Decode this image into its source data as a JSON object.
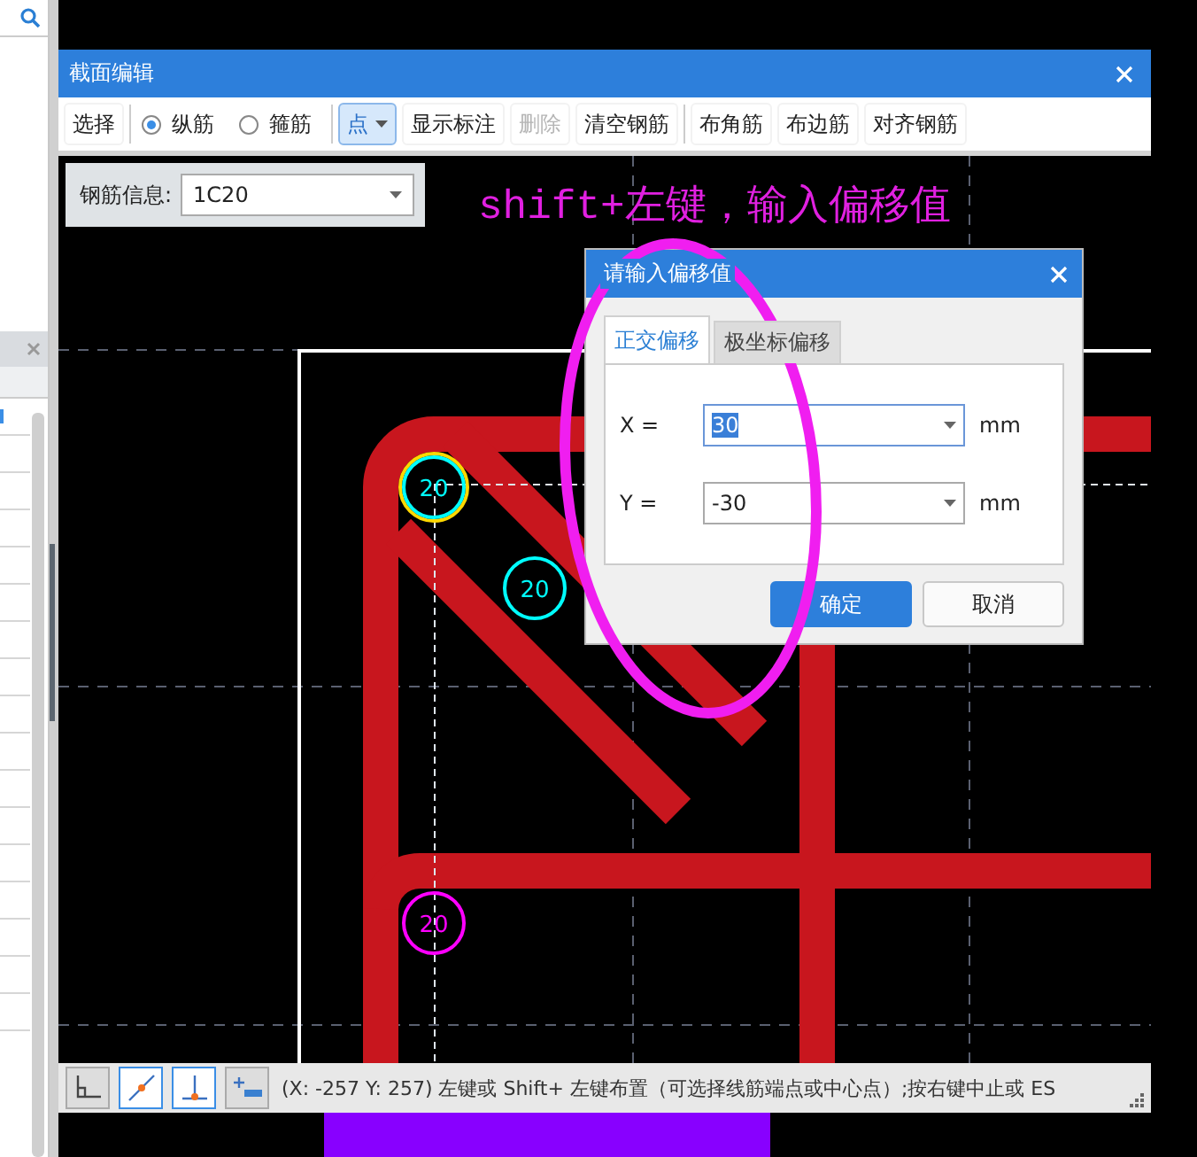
{
  "window": {
    "title": "截面编辑"
  },
  "toolbar": [
    {
      "kind": "button",
      "label": "选择",
      "disabled": false
    },
    {
      "kind": "separator"
    },
    {
      "kind": "radio",
      "label": "纵筋",
      "checked": true
    },
    {
      "kind": "radio",
      "label": "箍筋",
      "checked": false
    },
    {
      "kind": "separator"
    },
    {
      "kind": "dropdown",
      "label": "点",
      "selected": true
    },
    {
      "kind": "button",
      "label": "显示标注",
      "disabled": false
    },
    {
      "kind": "button",
      "label": "删除",
      "disabled": true
    },
    {
      "kind": "button",
      "label": "清空钢筋",
      "disabled": false
    },
    {
      "kind": "separator"
    },
    {
      "kind": "button",
      "label": "布角筋",
      "disabled": false
    },
    {
      "kind": "button",
      "label": "布边筋",
      "disabled": false
    },
    {
      "kind": "button",
      "label": "对齐钢筋",
      "disabled": false
    }
  ],
  "rebar_info": {
    "label": "钢筋信息:",
    "value": "1C20"
  },
  "annotation": "shift+左键，输入偏移值",
  "rebar_marks": [
    {
      "label": "20",
      "color": "#00ffff",
      "highlighted": true
    },
    {
      "label": "20",
      "color": "#00ffff",
      "highlighted": false
    },
    {
      "label": "20",
      "color": "#ff00ff",
      "highlighted": false
    }
  ],
  "dialog": {
    "title": "请输入偏移值",
    "tabs": [
      {
        "label": "正交偏移",
        "selected": true
      },
      {
        "label": "极坐标偏移",
        "selected": false
      }
    ],
    "fields": [
      {
        "label": "X =",
        "value": "30",
        "unit": "mm",
        "selected": true
      },
      {
        "label": "Y =",
        "value": "-30",
        "unit": "mm",
        "selected": false
      }
    ],
    "buttons": [
      {
        "label": "确定",
        "primary": true
      },
      {
        "label": "取消",
        "primary": false
      }
    ]
  },
  "status_bar": {
    "tools": [
      {
        "selected": false
      },
      {
        "selected": true
      },
      {
        "selected": true
      },
      {
        "selected": false
      }
    ],
    "message": "(X: -257 Y: 257)  左键或 Shift+ 左键布置（可选择线筋端点或中心点）;按右键中止或 ES"
  }
}
